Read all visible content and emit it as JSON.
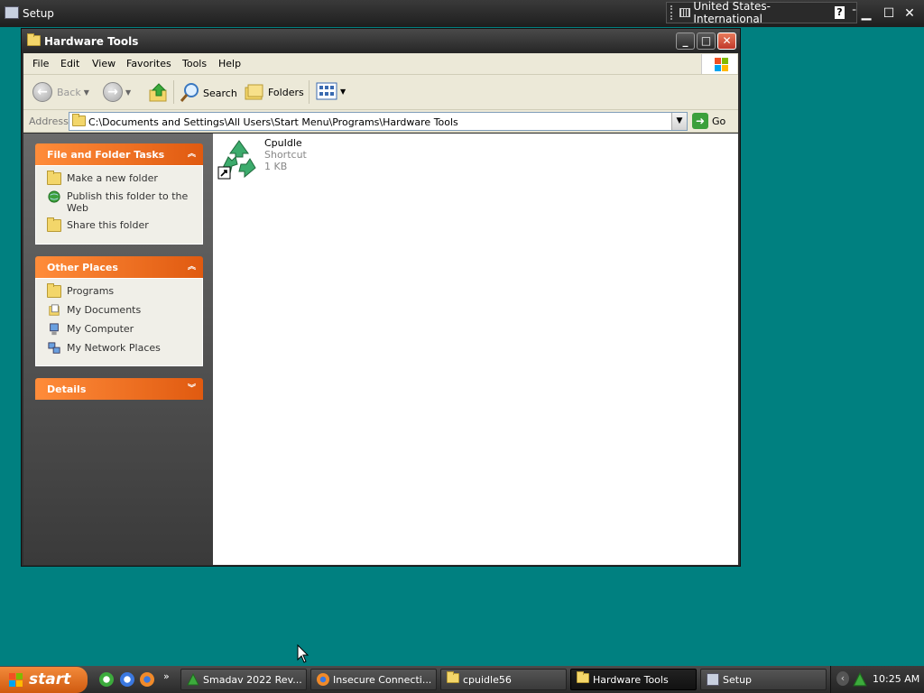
{
  "setup_bar": {
    "title": "Setup",
    "language": "United States-International",
    "help_label": "?",
    "options_label": "⁼"
  },
  "window": {
    "title": "Hardware Tools",
    "minimize_label": "_",
    "maximize_label": "□",
    "close_label": "✕"
  },
  "menu": [
    "File",
    "Edit",
    "View",
    "Favorites",
    "Tools",
    "Help"
  ],
  "toolbar": {
    "back_label": "Back",
    "search_label": "Search",
    "folders_label": "Folders"
  },
  "address": {
    "label": "Address",
    "path": "C:\\Documents and Settings\\All Users\\Start Menu\\Programs\\Hardware Tools",
    "go_label": "Go"
  },
  "panels": {
    "file_tasks": {
      "title": "File and Folder Tasks",
      "items": [
        "Make a new folder",
        "Publish this folder to the Web",
        "Share this folder"
      ]
    },
    "other_places": {
      "title": "Other Places",
      "items": [
        "Programs",
        "My Documents",
        "My Computer",
        "My Network Places"
      ]
    },
    "details": {
      "title": "Details"
    }
  },
  "files": [
    {
      "name": "CpuIdle",
      "type": "Shortcut",
      "size": "1 KB"
    }
  ],
  "taskbar": {
    "start_label": "start",
    "overflow_label": "»",
    "buttons": [
      {
        "label": "Smadav 2022 Rev..."
      },
      {
        "label": "Insecure Connecti..."
      },
      {
        "label": "cpuidle56"
      },
      {
        "label": "Hardware Tools"
      },
      {
        "label": "Setup"
      }
    ],
    "tray_expand_label": "‹",
    "clock": "10:25 AM"
  },
  "colors": {
    "desktop": "#008080",
    "panel_header": "#f07a2a",
    "close_button": "#d04a30"
  }
}
